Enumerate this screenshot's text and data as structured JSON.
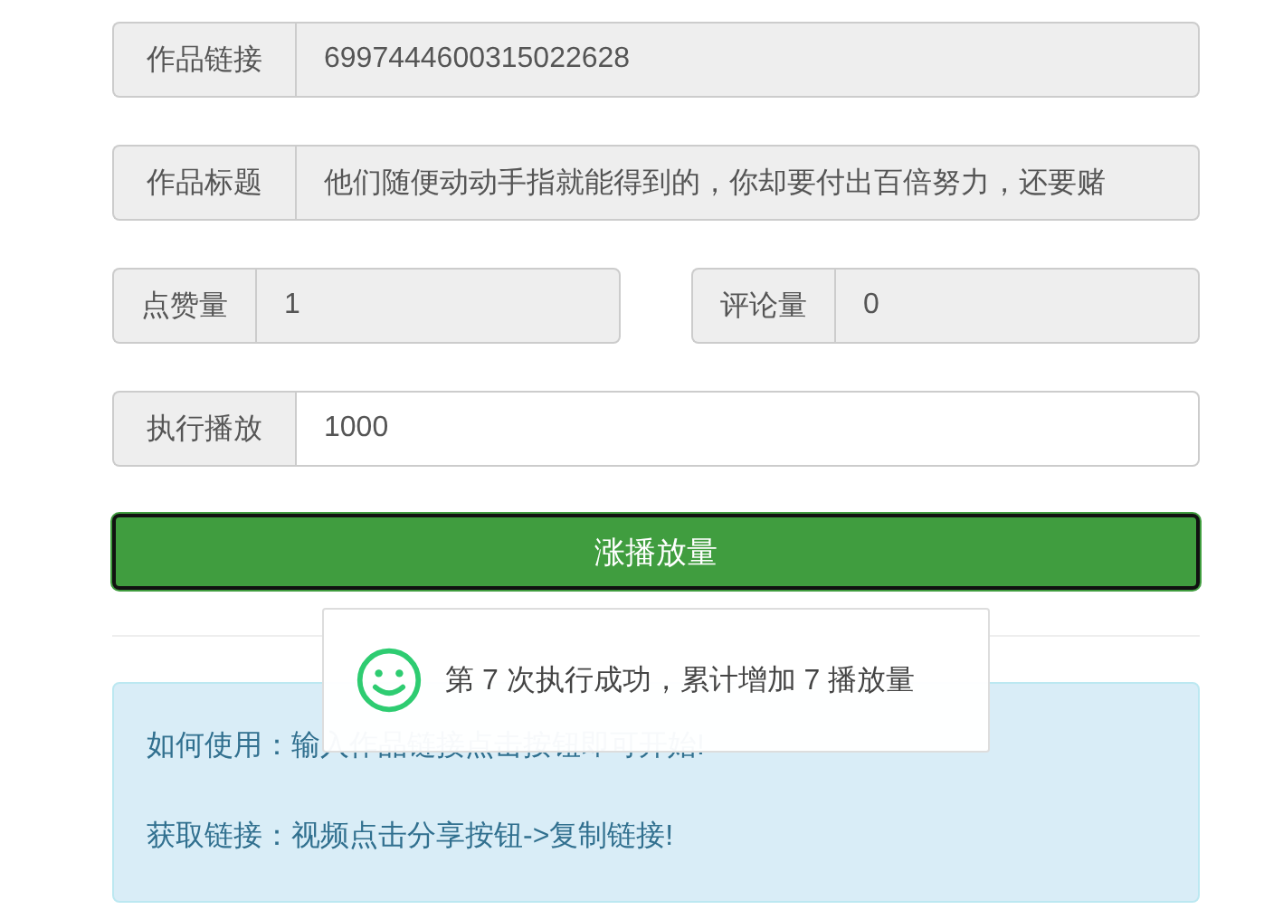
{
  "rows": [
    {
      "fields": [
        {
          "label": "作品链接",
          "value": "6997444600315022628",
          "disabled": true
        }
      ]
    },
    {
      "fields": [
        {
          "label": "作品标题",
          "value": "他们随便动动手指就能得到的，你却要付出百倍努力，还要赌",
          "disabled": true
        }
      ]
    },
    {
      "fields": [
        {
          "label": "点赞量",
          "value": "1",
          "disabled": true
        },
        {
          "label": "评论量",
          "value": "0",
          "disabled": true
        }
      ]
    },
    {
      "fields": [
        {
          "label": "执行播放",
          "value": "1000",
          "disabled": false
        }
      ]
    }
  ],
  "submit_button": {
    "label": "涨播放量"
  },
  "info": [
    "如何使用：输入作品链接点击按钮即可开始!",
    "获取链接：视频点击分享按钮->复制链接!"
  ],
  "toast": {
    "message": "第 7 次执行成功，累计增加 7 播放量"
  }
}
